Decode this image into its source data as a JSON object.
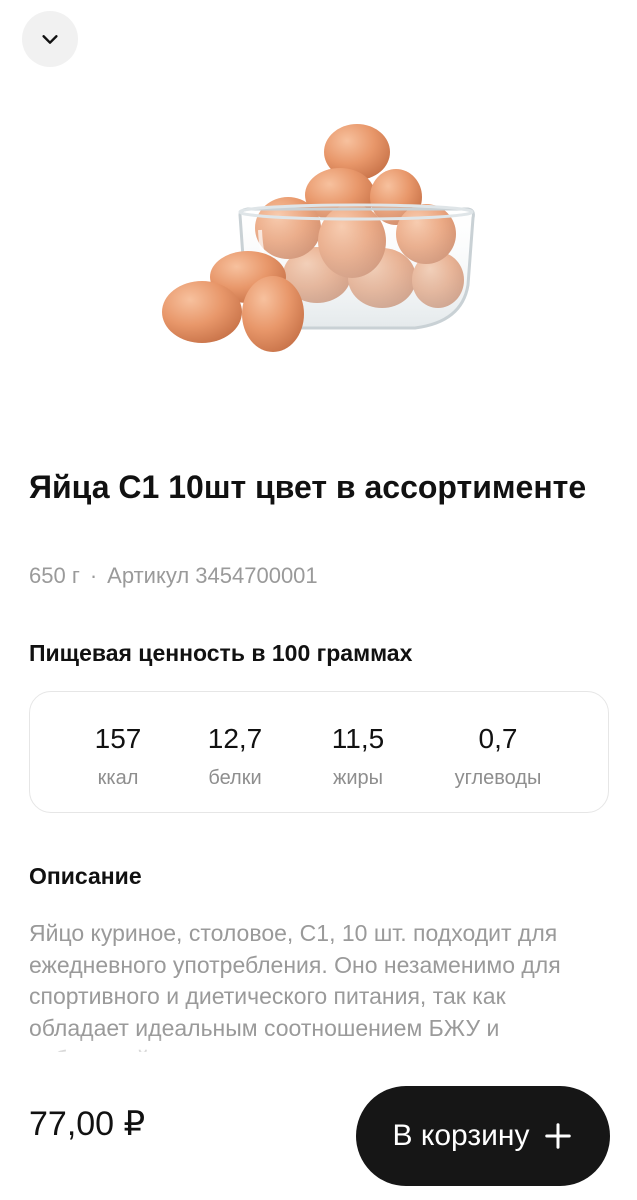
{
  "product": {
    "title": "Яйца С1 10шт цвет в ассортименте",
    "weight": "650 г",
    "separator": "·",
    "article": "Артикул 3454700001",
    "image_icon": "eggs-in-bowl-image"
  },
  "nutrition": {
    "heading": "Пищевая ценность в 100 граммах",
    "items": [
      {
        "value": "157",
        "label": "ккал"
      },
      {
        "value": "12,7",
        "label": "белки"
      },
      {
        "value": "11,5",
        "label": "жиры"
      },
      {
        "value": "0,7",
        "label": "углеводы"
      }
    ]
  },
  "description": {
    "heading": "Описание",
    "text": "Яйцо куриное, столовое, С1, 10 шт. подходит для ежедневного употребления. Оно незаменимо для спортивного и диетического питания, так как обладает идеальным соотношением БЖУ и небольшой"
  },
  "footer": {
    "price": "77,00 ₽",
    "cart_button": "В корзину"
  },
  "icons": {
    "collapse": "chevron-down-icon",
    "add": "plus-icon"
  },
  "colors": {
    "button_bg": "#161616",
    "muted_text": "#9a9a9a",
    "egg": "#e8976a"
  }
}
